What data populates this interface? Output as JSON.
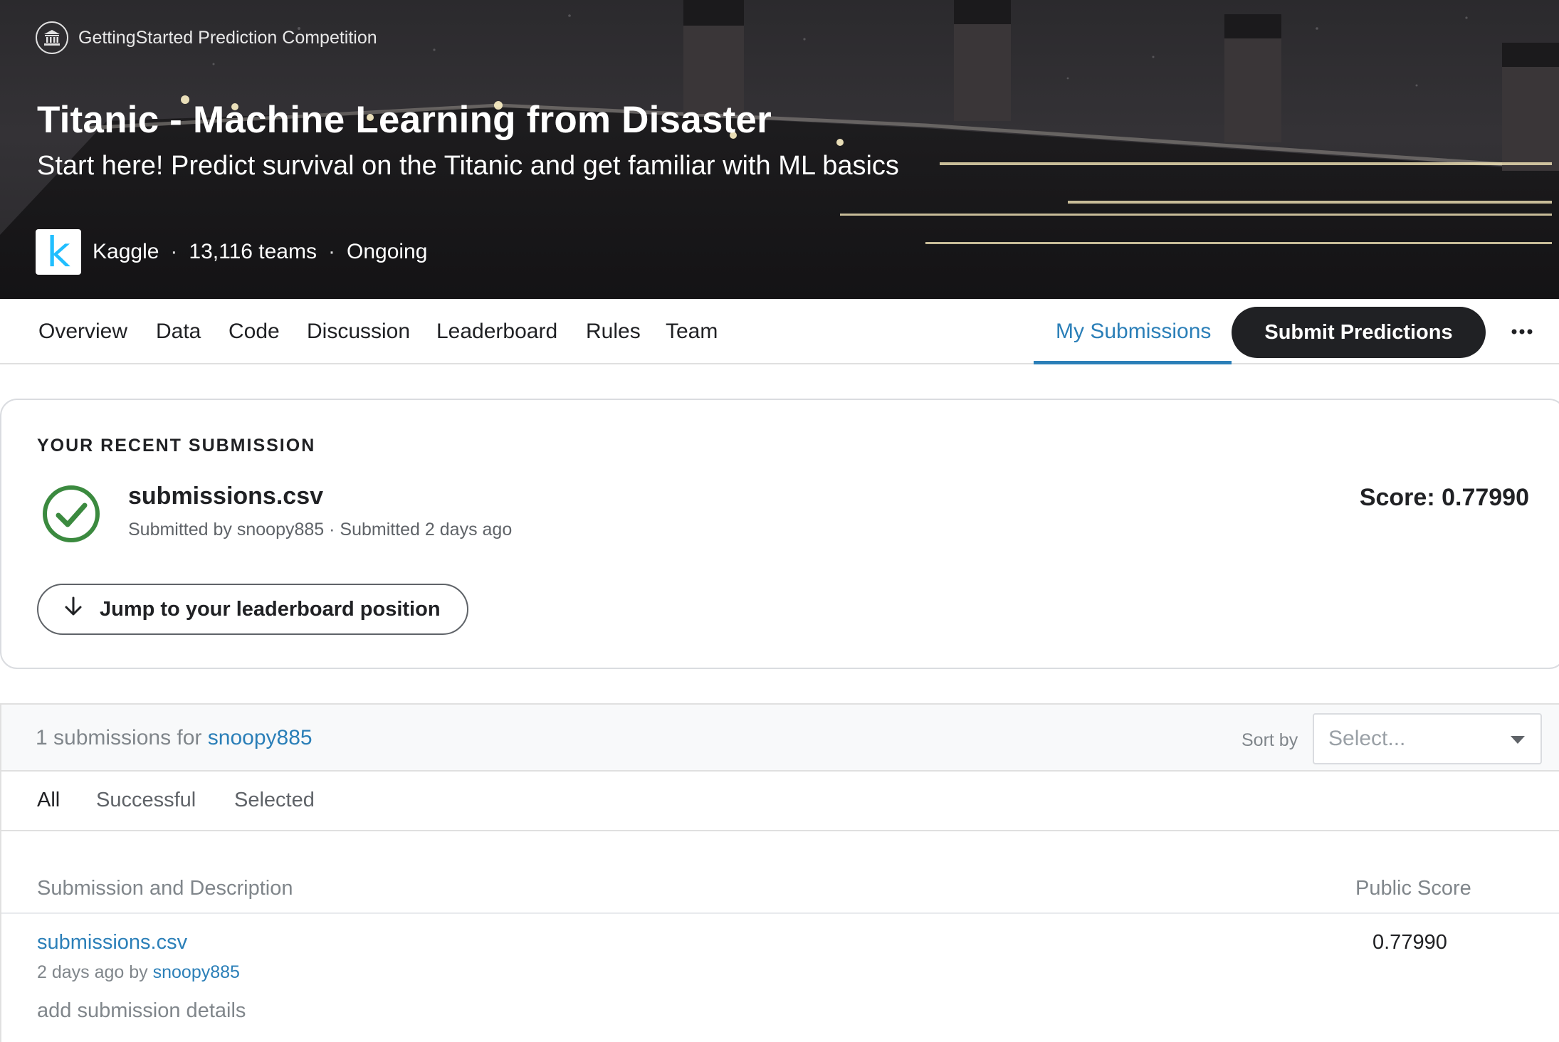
{
  "hero": {
    "competition_type": "GettingStarted Prediction Competition",
    "title": "Titanic - Machine Learning from Disaster",
    "subtitle": "Start here! Predict survival on the Titanic and get familiar with ML basics",
    "host_logo_letter": "k",
    "host": "Kaggle",
    "teams": "13,116 teams",
    "status": "Ongoing",
    "separator": "·"
  },
  "nav": {
    "tabs": [
      "Overview",
      "Data",
      "Code",
      "Discussion",
      "Leaderboard",
      "Rules",
      "Team"
    ],
    "my_submissions": "My Submissions",
    "submit_label": "Submit Predictions",
    "more_icon": "more-horizontal-icon"
  },
  "recent": {
    "label": "YOUR RECENT SUBMISSION",
    "filename": "submissions.csv",
    "byline": "Submitted by snoopy885 · Submitted 2 days ago",
    "score": "Score: 0.77990",
    "jump_label": "Jump to your leaderboard position",
    "status_icon": "check-circle-icon",
    "success_color": "#3b8a3f"
  },
  "submissions": {
    "count_prefix": "1 submissions for",
    "user": "snoopy885",
    "sort_label": "Sort by",
    "sort_placeholder": "Select...",
    "filters": [
      "All",
      "Successful",
      "Selected"
    ],
    "columns": {
      "submission": "Submission and Description",
      "public_score": "Public Score"
    },
    "rows": [
      {
        "name": "submissions.csv",
        "time": "2 days ago by",
        "user": "snoopy885",
        "description": "add submission details",
        "public_score": "0.77990"
      }
    ]
  },
  "colors": {
    "accent": "#2b7fb8",
    "dark_button": "#202124",
    "kaggle_blue": "#20beff"
  }
}
